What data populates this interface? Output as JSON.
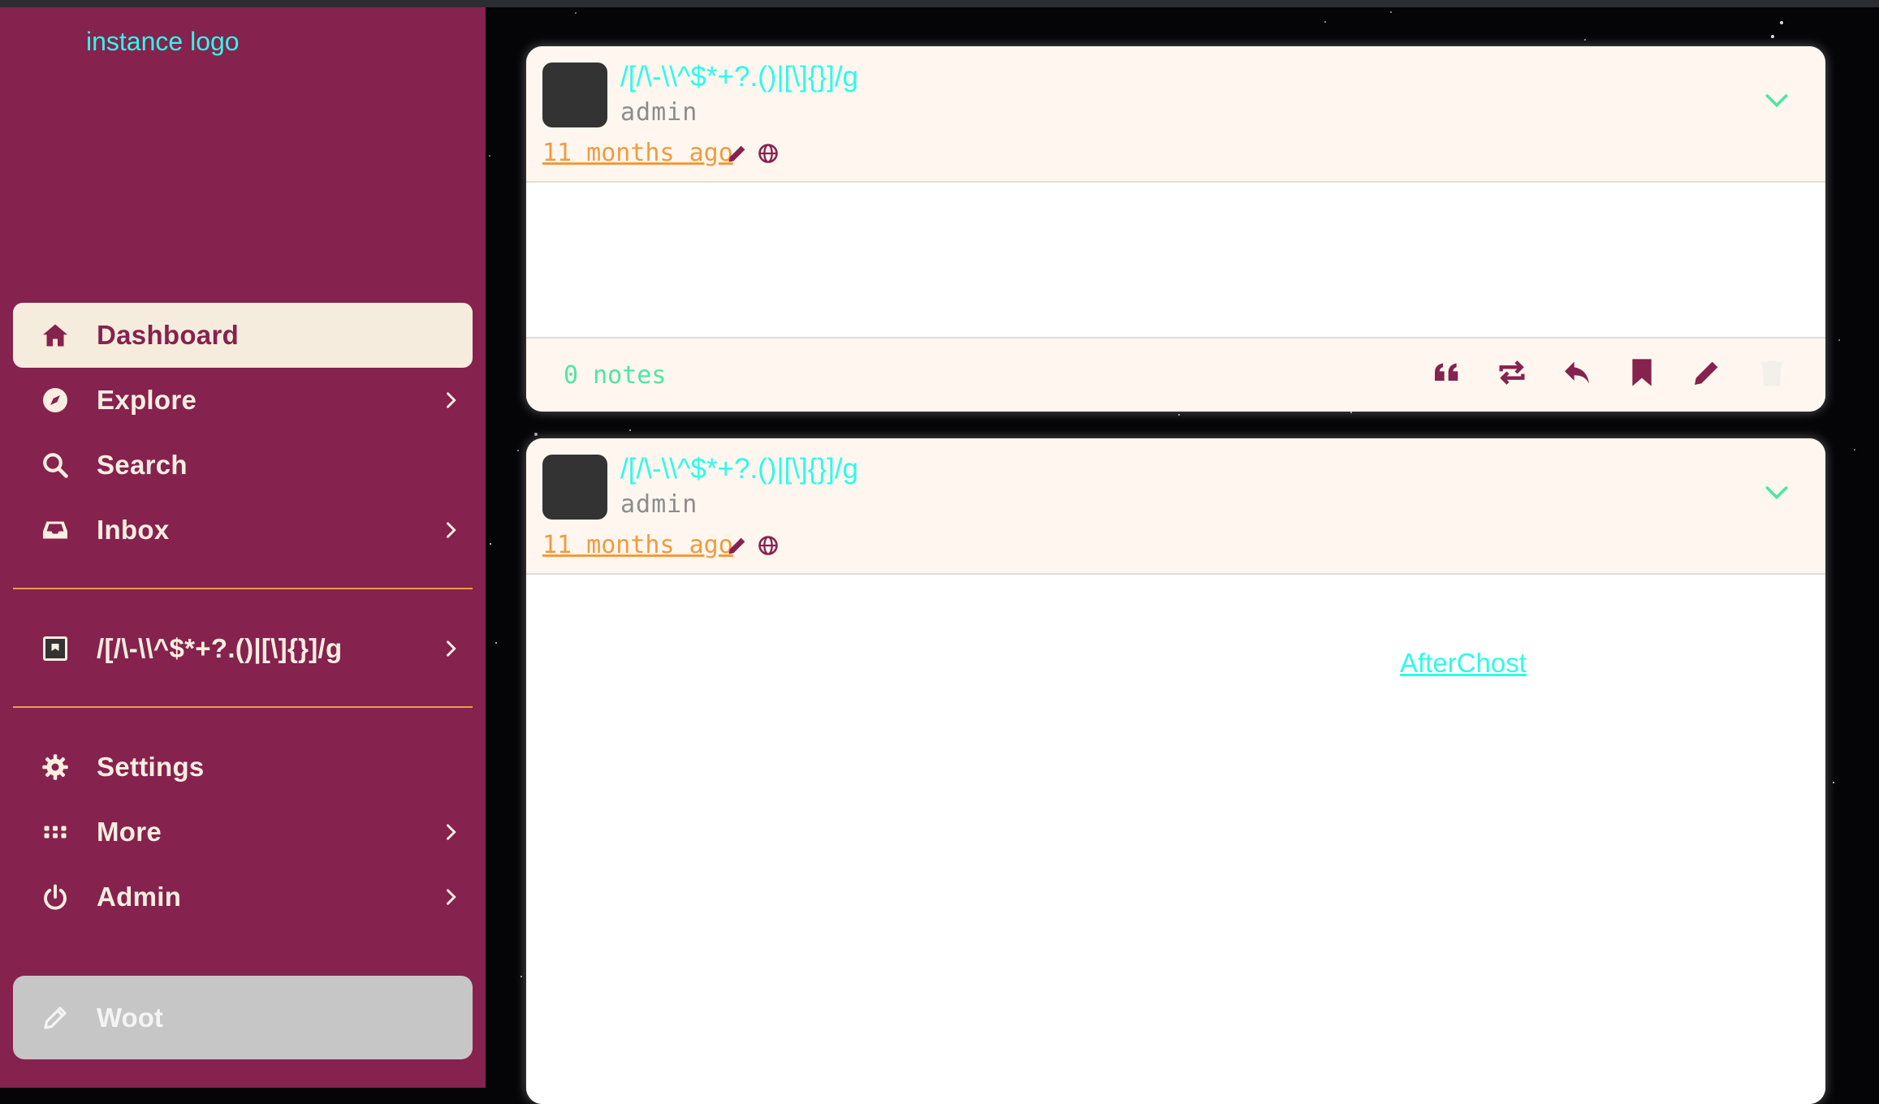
{
  "sidebar": {
    "logo": "instance logo",
    "items": [
      {
        "label": "Dashboard",
        "icon": "house-icon",
        "active": true
      },
      {
        "label": "Explore",
        "icon": "compass-icon"
      },
      {
        "label": "Search",
        "icon": "search-icon"
      },
      {
        "label": "Inbox",
        "icon": "inbox-icon"
      },
      {
        "label": "/[/\\-\\\\^$*+?.()|[\\]{}]/g",
        "icon": "blog-avatar-icon"
      },
      {
        "label": "Settings",
        "icon": "gear-icon"
      },
      {
        "label": "More",
        "icon": "grid-icon"
      },
      {
        "label": "Admin",
        "icon": "power-icon"
      }
    ],
    "write_button": "Woot"
  },
  "posts": [
    {
      "blog_name": "/[/\\-\\\\^$*+?.()|[\\]{}]/g",
      "author": "admin",
      "time": "11 months ago",
      "notes": "0 notes"
    },
    {
      "blog_name": "/[/\\-\\\\^$*+?.()|[\\]{}]/g",
      "author": "admin",
      "time": "11 months ago",
      "link_text": "AfterChost"
    }
  ],
  "colors": {
    "sidebar_bg": "#85224e",
    "accent_cyan": "#2dfbe9",
    "accent_orange": "#f29a3f",
    "accent_green": "#4ee6a2",
    "card_bg": "#fff7ef"
  }
}
